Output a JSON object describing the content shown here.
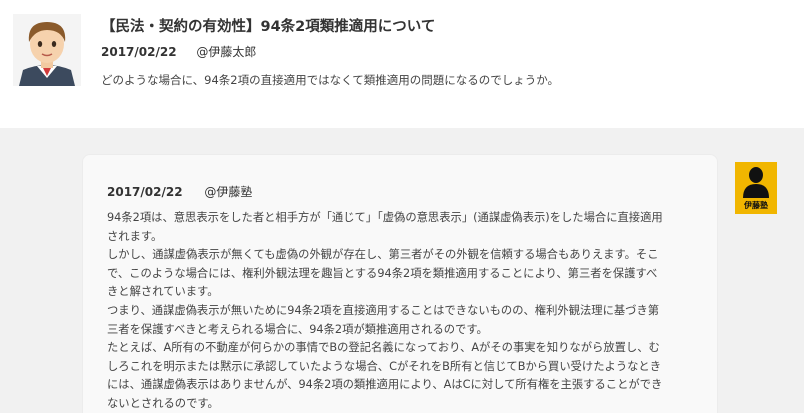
{
  "question": {
    "avatar_icon": "user-avatar-icon",
    "title": "【民法・契約の有効性】94条2項類推適用について",
    "date": "2017/02/22",
    "author": "@伊藤太郎",
    "body": "どのような場合に、94条2項の直接適用ではなくて類推適用の問題になるのでしょうか。"
  },
  "answer": {
    "date": "2017/02/22",
    "author": "@伊藤塾",
    "avatar_icon": "person-silhouette-icon",
    "avatar_label": "伊藤塾",
    "avatar_color": "#f1b600",
    "lines": [
      "94条2項は、意思表示をした者と相手方が「通じて」「虚偽の意思表示」(通謀虚偽表示)をした場合に直接適用",
      "されます。",
      "しかし、通謀虚偽表示が無くても虚偽の外観が存在し、第三者がその外観を信頼する場合もありえます。そこ",
      "で、このような場合には、権利外観法理を趣旨とする94条2項を類推適用することにより、第三者を保護すべ",
      "きと解されています。",
      "つまり、通謀虚偽表示が無いために94条2項を直接適用することはできないものの、権利外観法理に基づき第",
      "三者を保護すべきと考えられる場合に、94条2項が類推適用されるのです。",
      "たとえば、A所有の不動産が何らかの事情でBの登記名義になっており、Aがその事実を知りながら放置し、む",
      "しろこれを明示または黙示に承認していたような場合、CがそれをB所有と信じてBから買い受けたようなとき",
      "には、通謀虚偽表示はありませんが、94条2項の類推適用により、AはCに対して所有権を主張することができ",
      "ないとされるのです。"
    ]
  }
}
